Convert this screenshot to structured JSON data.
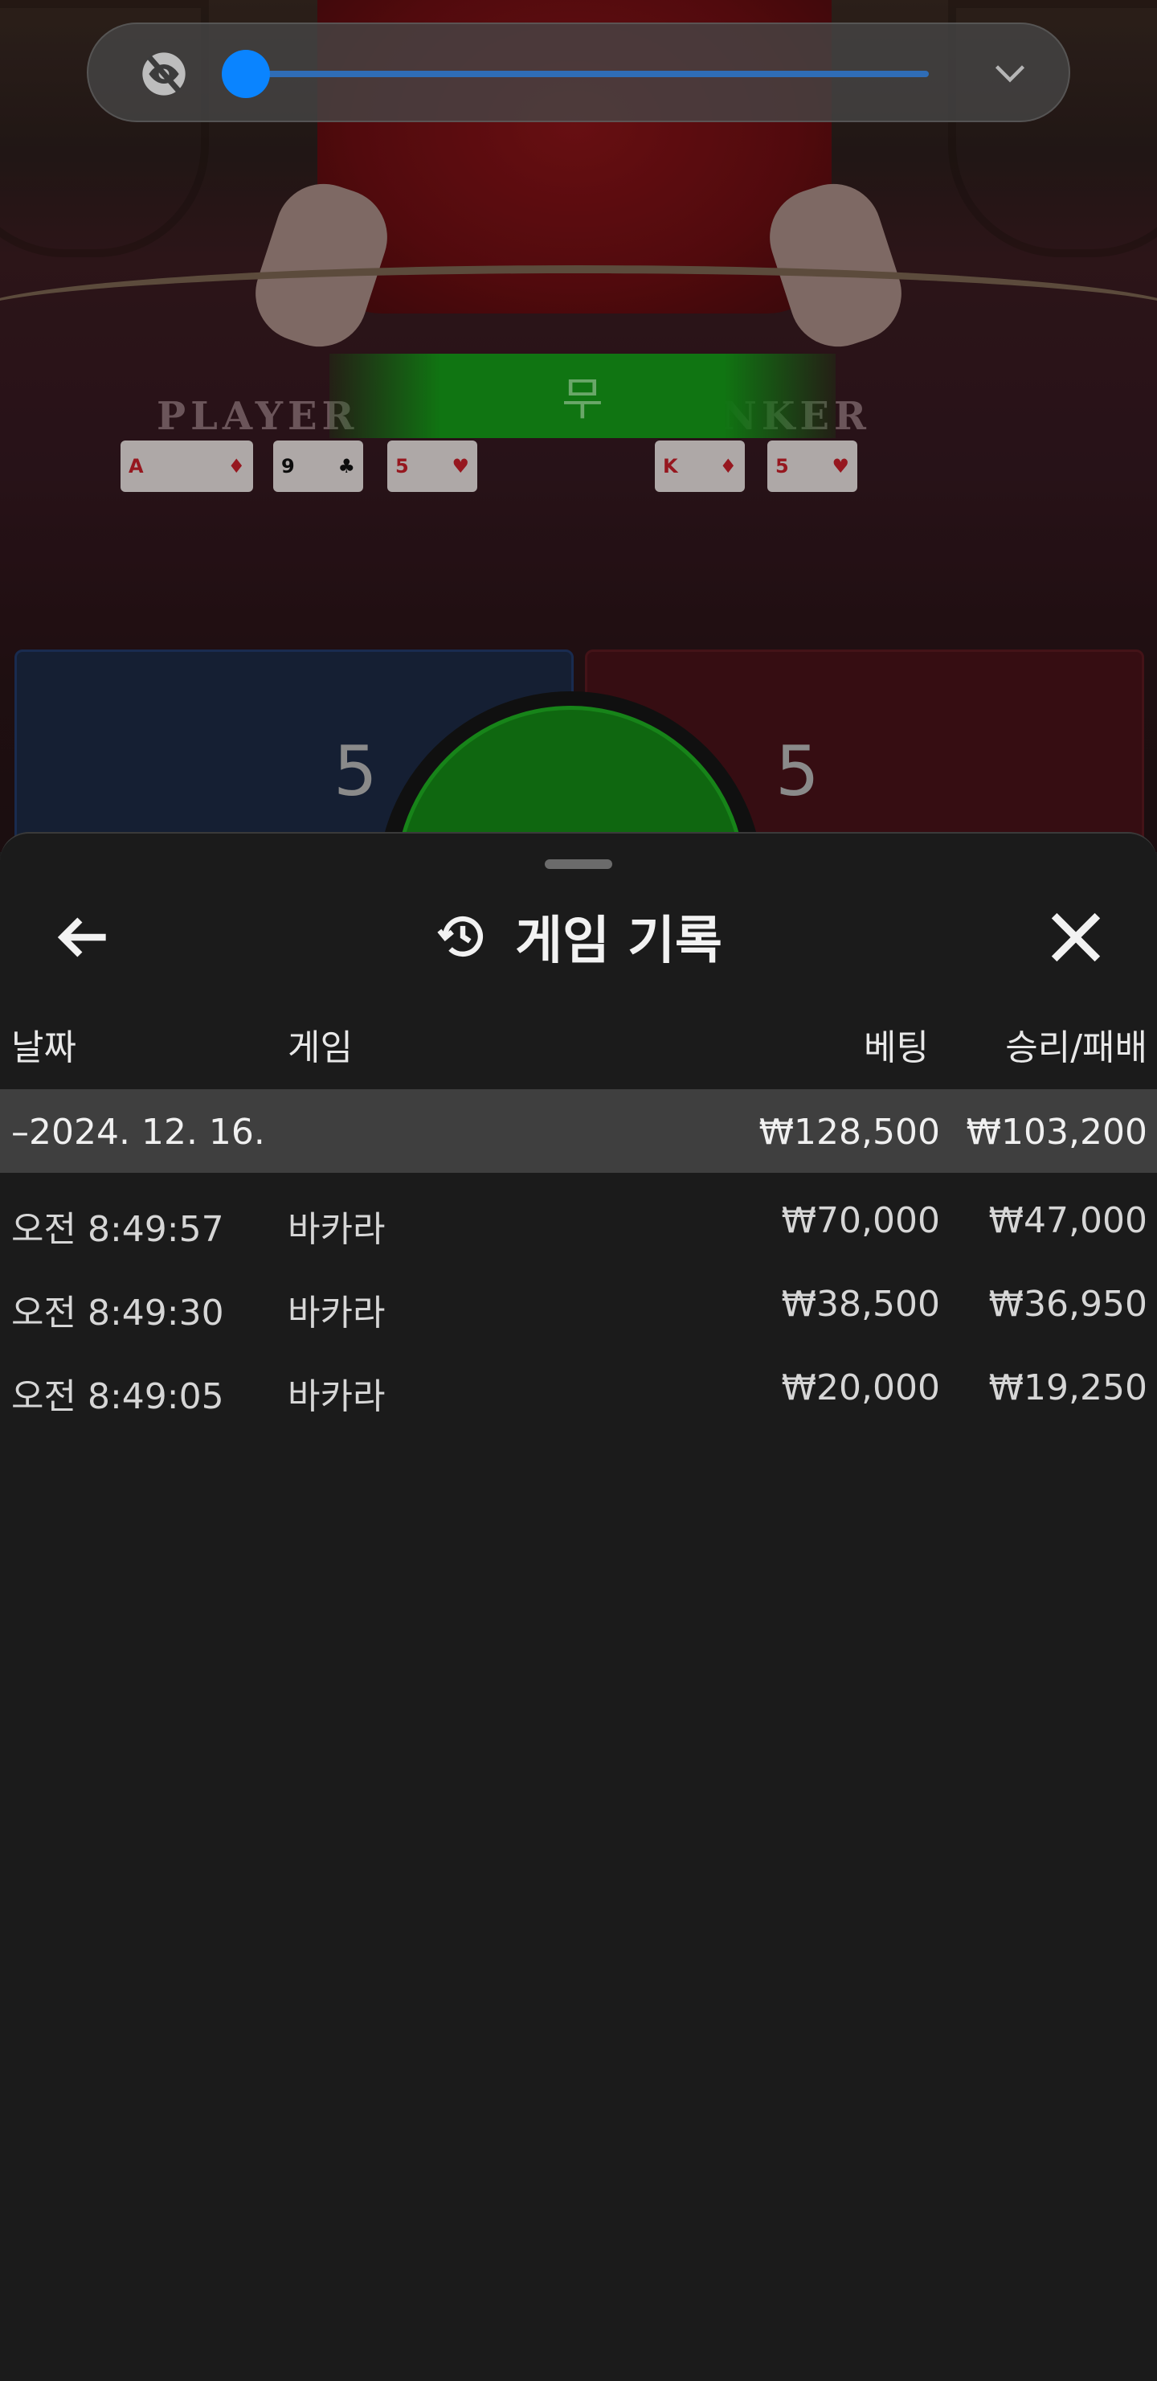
{
  "game_view": {
    "result_label": "무",
    "player_word": "PLAYER",
    "banker_word": "BANKER",
    "player_score": "5",
    "banker_score": "5",
    "player_cards": [
      {
        "rank": "A",
        "suit": "♦",
        "color": "red"
      },
      {
        "rank": "9",
        "suit": "♣",
        "color": "black"
      },
      {
        "rank": "5",
        "suit": "♥",
        "color": "red"
      }
    ],
    "banker_cards": [
      {
        "rank": "K",
        "suit": "♦",
        "color": "red"
      },
      {
        "rank": "5",
        "suit": "♥",
        "color": "red"
      }
    ]
  },
  "video_control": {
    "visibility_icon": "eye-off-icon",
    "expand_icon": "chevron-down-icon",
    "slider_level": 0.0,
    "accent": "#0a84ff"
  },
  "sheet": {
    "title": "게임 기록",
    "title_icon": "history-icon",
    "back_icon": "arrow-left-icon",
    "close_icon": "close-icon",
    "columns": {
      "date": "날짜",
      "game": "게임",
      "bet": "베팅",
      "winloss": "승리/패배"
    },
    "date_group": {
      "label": "–2024. 12. 16.",
      "bet_total": "₩128,500",
      "winloss_total": "₩103,200"
    },
    "rows": [
      {
        "time": "오전 8:49:57",
        "game": "바카라",
        "bet": "₩70,000",
        "winloss": "₩47,000"
      },
      {
        "time": "오전 8:49:30",
        "game": "바카라",
        "bet": "₩38,500",
        "winloss": "₩36,950"
      },
      {
        "time": "오전 8:49:05",
        "game": "바카라",
        "bet": "₩20,000",
        "winloss": "₩19,250"
      }
    ]
  }
}
